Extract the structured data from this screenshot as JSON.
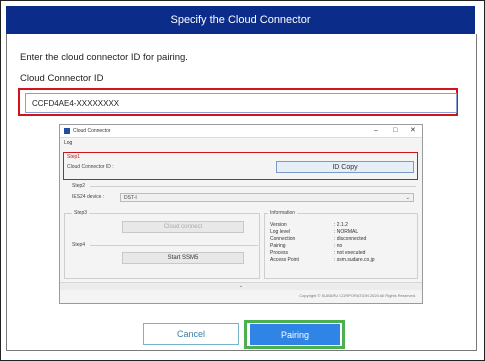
{
  "dialog": {
    "title": "Specify the Cloud Connector",
    "instruction": "Enter the cloud connector ID for pairing.",
    "field_label": "Cloud Connector ID",
    "field_value": "CCFD4AE4-XXXXXXXX"
  },
  "inner_window": {
    "title": "Cloud Connector",
    "minimize_glyph": "–",
    "maximize_glyph": "□",
    "close_glyph": "✕",
    "menu": "Log",
    "step1": {
      "label": "Step1",
      "id_label": "Cloud Connector ID :",
      "id_copy_button": "ID Copy"
    },
    "step2": {
      "label": "Step2",
      "device_label": "IES24 device :",
      "device_value": "DST-I"
    },
    "step3": {
      "label": "Step3",
      "cloud_connect_button": "Cloud connect"
    },
    "step4": {
      "label": "Step4",
      "start_button": "Start SSM5"
    },
    "information": {
      "label": "Information",
      "rows": [
        {
          "key": "Version",
          "value": ": 2.1.2"
        },
        {
          "key": "Log level",
          "value": ": NORMAL"
        },
        {
          "key": "Connection",
          "value": ": disconnected"
        },
        {
          "key": "Pairing",
          "value": ": no"
        },
        {
          "key": "Process",
          "value": ": not executed"
        },
        {
          "key": "Access Point",
          "value": ": ssm.sudare.co.jp"
        }
      ]
    },
    "expand_glyph": "⌄",
    "copyright": "Copyright © SUBARU CORPORATION 2020 All Rights Reserved."
  },
  "buttons": {
    "cancel": "Cancel",
    "pairing": "Pairing"
  },
  "colors": {
    "title_bar": "#0c2c8a",
    "highlight_red": "#d0141b",
    "highlight_green": "#4caf50",
    "primary_button": "#2f84e6",
    "cancel_border": "#7ab3cc"
  }
}
